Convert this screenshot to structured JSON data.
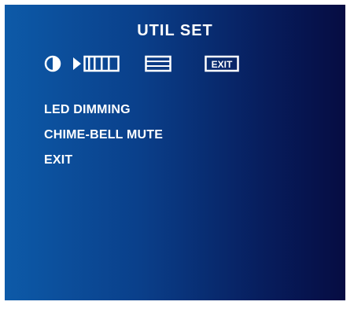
{
  "screen": {
    "title": "UTIL SET"
  },
  "tab_icons": [
    {
      "name": "contrast-icon"
    },
    {
      "name": "selected-pointer-icon"
    },
    {
      "name": "util-bars-icon",
      "active": true
    },
    {
      "name": "display-panel-icon"
    },
    {
      "name": "exit-icon",
      "label": "EXIT"
    }
  ],
  "menu": {
    "items": [
      {
        "label": "LED DIMMING"
      },
      {
        "label": "CHIME-BELL MUTE"
      },
      {
        "label": "EXIT"
      }
    ]
  },
  "colors": {
    "gradient_left": "#0d5aa8",
    "gradient_right": "#060c42",
    "text": "#ffffff"
  }
}
